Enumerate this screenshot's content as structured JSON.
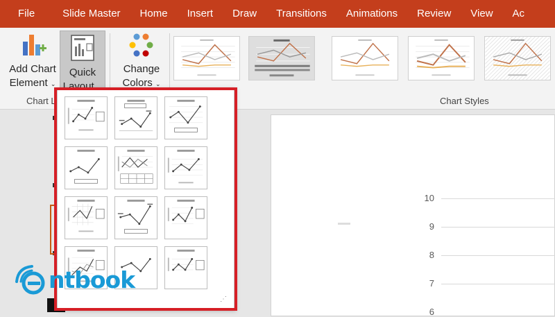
{
  "ribbon_tabs": [
    "File",
    "Slide Master",
    "Home",
    "Insert",
    "Draw",
    "Transitions",
    "Animations",
    "Review",
    "View",
    "Ac"
  ],
  "buttons": {
    "add_chart_element": "Add Chart\nElement",
    "add_chart_element_line1": "Add Chart",
    "add_chart_element_line2": "Element",
    "quick_layout_line1": "Quick",
    "quick_layout_line2": "Layout",
    "change_colors_line1": "Change",
    "change_colors_line2": "Colors"
  },
  "group_labels": {
    "chart_layouts": "Chart L",
    "chart_styles": "Chart Styles"
  },
  "chart_styles_count": 5,
  "quick_layout_options_count": 12,
  "slide_axis": {
    "y_ticks": [
      "10",
      "9",
      "8",
      "7",
      "6"
    ]
  },
  "watermark": {
    "text": "ntbook"
  },
  "colors": {
    "ribbon_accent": "#c43e1c",
    "highlight": "#d61f26",
    "logo": "#1a9ad6"
  }
}
